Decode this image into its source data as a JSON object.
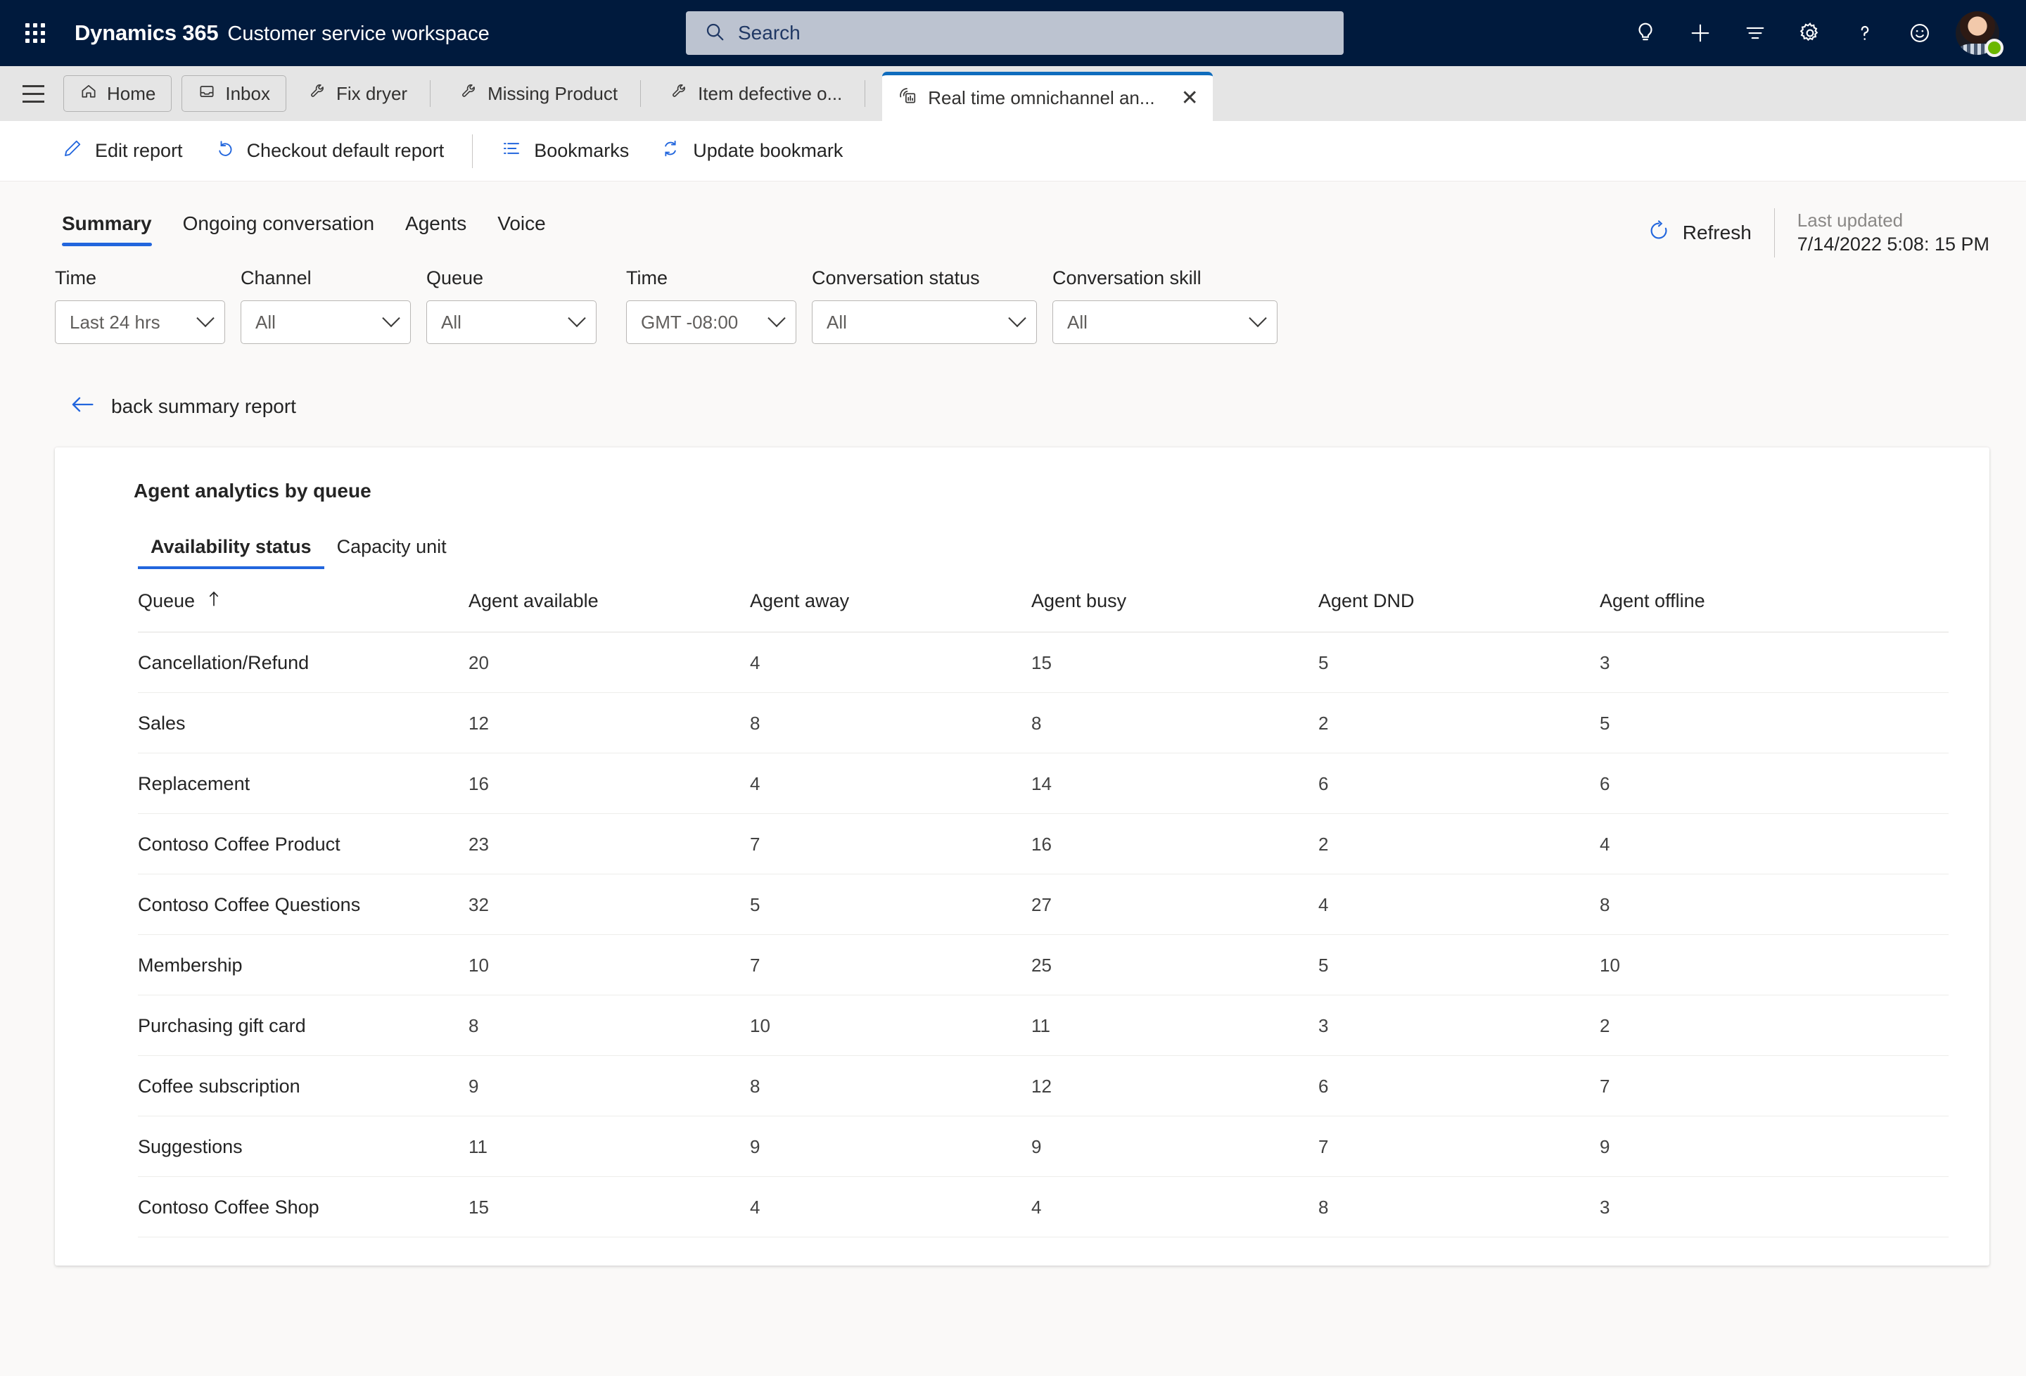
{
  "topnav": {
    "waffle_icon": "waffle-grid-icon",
    "brand_main": "Dynamics 365",
    "brand_sub": "Customer service workspace",
    "search": {
      "placeholder": "Search",
      "value": "",
      "icon": "search-icon"
    },
    "icons": [
      {
        "name": "lightbulb-icon",
        "label": "Lightbulb"
      },
      {
        "name": "plus-icon",
        "label": "New"
      },
      {
        "name": "filter-list-icon",
        "label": "Filter"
      },
      {
        "name": "gear-icon",
        "label": "Settings"
      },
      {
        "name": "question-mark-icon",
        "label": "Help"
      },
      {
        "name": "smiley-icon",
        "label": "Feedback"
      }
    ],
    "avatar": {
      "name": "user-avatar",
      "presence": "available",
      "presence_color": "#6bb700"
    }
  },
  "tabstrip": {
    "hamburger_icon": "hamburger-menu-icon",
    "home": {
      "label": "Home",
      "icon": "home-icon"
    },
    "inbox": {
      "label": "Inbox",
      "icon": "inbox-icon"
    },
    "sessions": [
      {
        "label": "Fix dryer",
        "icon": "wrench-icon",
        "active": false
      },
      {
        "label": "Missing Product",
        "icon": "wrench-icon",
        "active": false
      },
      {
        "label": "Item defective o...",
        "icon": "wrench-icon",
        "active": false
      }
    ],
    "active_session": {
      "label": "Real time omnichannel an...",
      "icon": "dashboard-chart-icon",
      "close_icon": "close-icon"
    }
  },
  "commandbar": {
    "items": [
      {
        "label": "Edit report",
        "icon": "pencil-icon"
      },
      {
        "label": "Checkout default report",
        "icon": "undo-icon"
      },
      {
        "label": "Bookmarks",
        "icon": "bookmark-list-icon"
      },
      {
        "label": "Update bookmark",
        "icon": "refresh-sync-icon"
      }
    ]
  },
  "report": {
    "tabs": [
      {
        "label": "Summary",
        "active": true
      },
      {
        "label": "Ongoing conversation",
        "active": false
      },
      {
        "label": "Agents",
        "active": false
      },
      {
        "label": "Voice",
        "active": false
      }
    ],
    "refresh": {
      "label": "Refresh",
      "icon": "refresh-icon"
    },
    "last_updated_label": "Last updated",
    "last_updated_value": "7/14/2022 5:08: 15 PM",
    "accent_color": "#2266dd"
  },
  "filters": [
    {
      "label": "Time",
      "value": "Last 24 hrs",
      "wide": false
    },
    {
      "label": "Channel",
      "value": "All",
      "wide": false
    },
    {
      "label": "Queue",
      "value": "All",
      "wide": false
    },
    {
      "label": "Time",
      "value": "GMT -08:00",
      "wide": false
    },
    {
      "label": "Conversation status",
      "value": "All",
      "wide": false
    },
    {
      "label": "Conversation skill",
      "value": "All",
      "wide": false
    }
  ],
  "back_link": {
    "label": "back summary report",
    "icon": "arrow-left-icon"
  },
  "card": {
    "title": "Agent analytics by queue",
    "subtabs": [
      {
        "label": "Availability status",
        "active": true
      },
      {
        "label": "Capacity unit",
        "active": false
      }
    ]
  },
  "chart_data": {
    "type": "table",
    "title": "Agent analytics by queue",
    "sort": {
      "column": "Queue",
      "direction": "asc",
      "icon": "sort-ascending-icon"
    },
    "columns": [
      "Queue",
      "Agent available",
      "Agent away",
      "Agent busy",
      "Agent DND",
      "Agent offline"
    ],
    "rows": [
      [
        "Cancellation/Refund",
        "20",
        "4",
        "15",
        "5",
        "3"
      ],
      [
        "Sales",
        "12",
        "8",
        "8",
        "2",
        "5"
      ],
      [
        "Replacement",
        "16",
        "4",
        "14",
        "6",
        "6"
      ],
      [
        "Contoso Coffee Product",
        "23",
        "7",
        "16",
        "2",
        "4"
      ],
      [
        "Contoso Coffee Questions",
        "32",
        "5",
        "27",
        "4",
        "8"
      ],
      [
        "Membership",
        "10",
        "7",
        "25",
        "5",
        "10"
      ],
      [
        "Purchasing gift card",
        "8",
        "10",
        "11",
        "3",
        "2"
      ],
      [
        "Coffee subscription",
        "9",
        "8",
        "12",
        "6",
        "7"
      ],
      [
        "Suggestions",
        "11",
        "9",
        "9",
        "7",
        "9"
      ],
      [
        "Contoso Coffee Shop",
        "15",
        "4",
        "4",
        "8",
        "3"
      ]
    ]
  }
}
